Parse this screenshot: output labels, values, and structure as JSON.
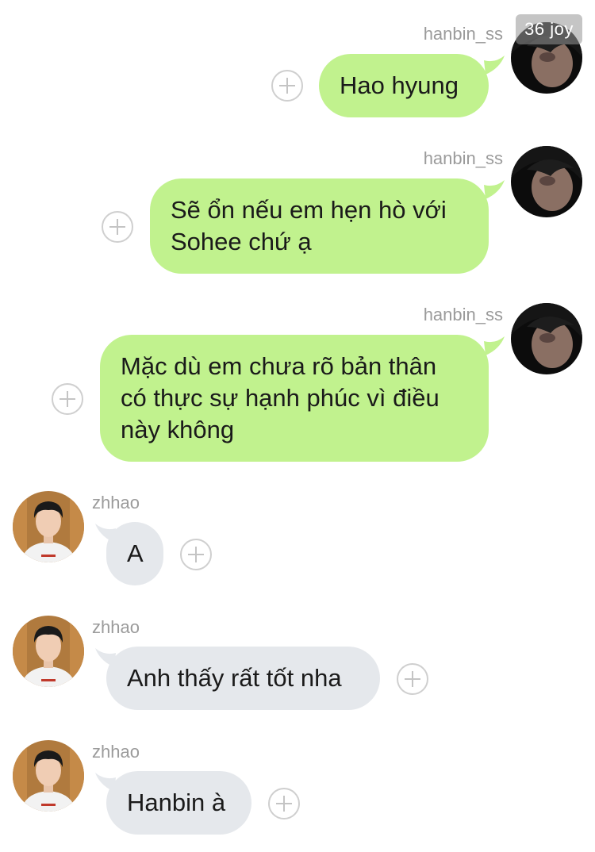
{
  "watermark": "36 joy",
  "messages": [
    {
      "sender": "hanbin_ss",
      "text": "Hao hyung",
      "direction": "outgoing"
    },
    {
      "sender": "hanbin_ss",
      "text": "Sẽ ổn nếu em hẹn hò với Sohee chứ ạ",
      "direction": "outgoing"
    },
    {
      "sender": "hanbin_ss",
      "text": "Mặc dù em chưa rõ bản thân có thực sự hạnh phúc vì điều này không",
      "direction": "outgoing"
    },
    {
      "sender": "zhhao",
      "text": "A",
      "direction": "incoming"
    },
    {
      "sender": "zhhao",
      "text": "Anh thấy rất tốt nha",
      "direction": "incoming"
    },
    {
      "sender": "zhhao",
      "text": "Hanbin à",
      "direction": "incoming"
    }
  ],
  "colors": {
    "outgoing_bubble": "#c1f28e",
    "incoming_bubble": "#e5e8ec",
    "sender_name": "#9b9b9b"
  },
  "icons": {
    "reaction_button": "plus-circle-icon"
  }
}
